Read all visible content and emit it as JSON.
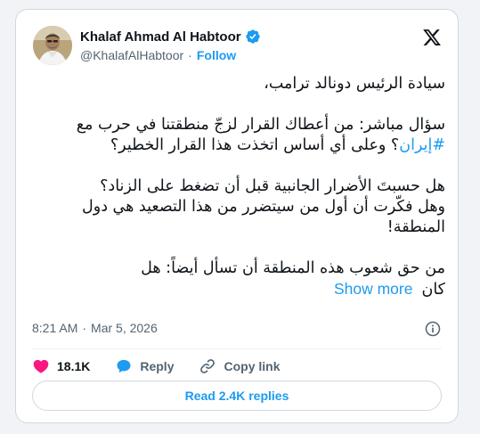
{
  "tweet": {
    "author_name": "Khalaf Ahmad Al Habtoor",
    "handle": "@KhalafAlHabtoor",
    "separator": "·",
    "follow_label": "Follow",
    "text": {
      "line1": "سيادة الرئيس دونالد ترامب،",
      "para2_part1": "سؤال مباشر: من أعطاك القرار لزجّ منطقتنا في حرب مع",
      "hashtag": "#إيران",
      "para2_part2": "؟ وعلى أي أساس اتخذت هذا القرار الخطير؟",
      "para3_line1": "هل حسبتَ الأضرار الجانبية قبل أن تضغط على الزناد؟",
      "para3_line2": "وهل فكّرت أن أول من سيتضرر من هذا التصعيد هي دول المنطقة!",
      "para4_line1": "من حق شعوب هذه المنطقة أن تسأل أيضاً: هل",
      "para4_line2": "كان"
    },
    "show_more_label": "Show more",
    "time": "8:21 AM",
    "date": "Mar 5, 2026",
    "likes": "18.1K",
    "reply_label": "Reply",
    "copy_link_label": "Copy link",
    "read_replies_label": "Read 2.4K replies"
  },
  "icons": {
    "avatar": "avatar",
    "verified": "verified-badge-icon",
    "logo": "x-logo-icon",
    "info": "info-icon",
    "like": "heart-icon",
    "reply": "reply-bubble-icon",
    "link": "link-icon"
  },
  "colors": {
    "accent": "#1d9bf0",
    "like": "#f91880",
    "text": "#0f1419",
    "muted": "#536471"
  }
}
